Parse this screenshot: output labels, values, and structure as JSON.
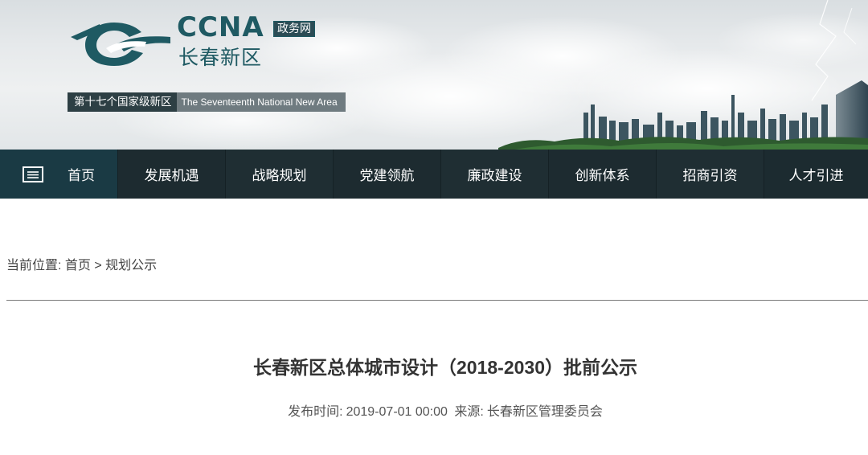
{
  "header": {
    "logo_en": "CCNA",
    "logo_cn": "长春新区",
    "badge": "政务网",
    "tagline_cn": "第十七个国家级新区",
    "tagline_en": "The Seventeenth National New Area"
  },
  "nav": {
    "menu_icon": "menu-icon",
    "items": [
      "首页",
      "发展机遇",
      "战略规划",
      "党建领航",
      "廉政建设",
      "创新体系",
      "招商引资",
      "人才引进"
    ]
  },
  "breadcrumb": {
    "label": "当前位置:",
    "home": "首页",
    "separator": ">",
    "current": "规划公示"
  },
  "article": {
    "title": "长春新区总体城市设计（2018-2030）批前公示",
    "publish_label": "发布时间:",
    "publish_time": "2019-07-01 00:00",
    "source_label": "来源:",
    "source": "长春新区管理委员会"
  }
}
